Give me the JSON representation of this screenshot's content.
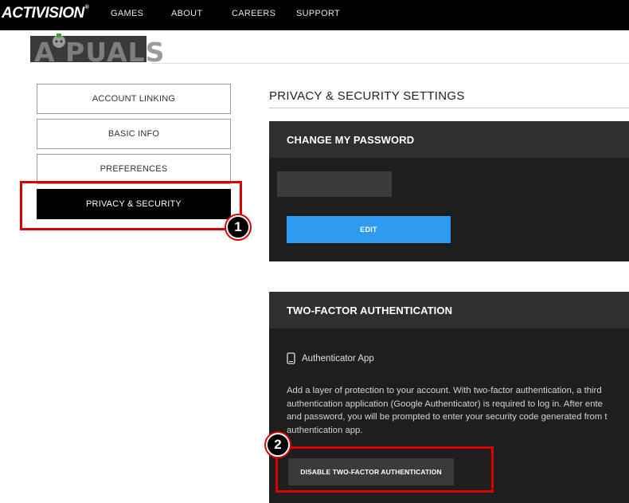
{
  "header": {
    "logo_text": "ACTIVISION",
    "logo_mark": "®",
    "nav": [
      "GAMES",
      "ABOUT",
      "CAREERS",
      "SUPPORT"
    ]
  },
  "watermark": "A PUALS",
  "sidebar": {
    "items": [
      {
        "label": "ACCOUNT LINKING"
      },
      {
        "label": "BASIC INFO"
      },
      {
        "label": "PREFERENCES"
      },
      {
        "label": "PRIVACY & SECURITY",
        "active": true
      }
    ]
  },
  "annotations": {
    "step1": "1",
    "step2": "2",
    "highlight_color": "#d90000"
  },
  "main": {
    "title": "PRIVACY & SECURITY SETTINGS",
    "password_panel": {
      "heading": "CHANGE MY PASSWORD",
      "edit_label": "EDIT"
    },
    "tfa_panel": {
      "heading": "TWO-FACTOR AUTHENTICATION",
      "method_label": "Authenticator App",
      "method_icon": "phone-icon",
      "description_lines": [
        "Add a layer of protection to your account. With two-factor authentication, a third",
        "authentication application (Google Authenticator) is required to log in. After ente",
        "and password, you will be prompted to enter your security code generated from t",
        "authentication app."
      ],
      "disable_label": "DISABLE TWO-FACTOR AUTHENTICATION"
    }
  },
  "colors": {
    "accent_blue": "#2e9bf0",
    "panel_dark": "#1e1e1e",
    "panel_header": "#2f2f2f"
  }
}
